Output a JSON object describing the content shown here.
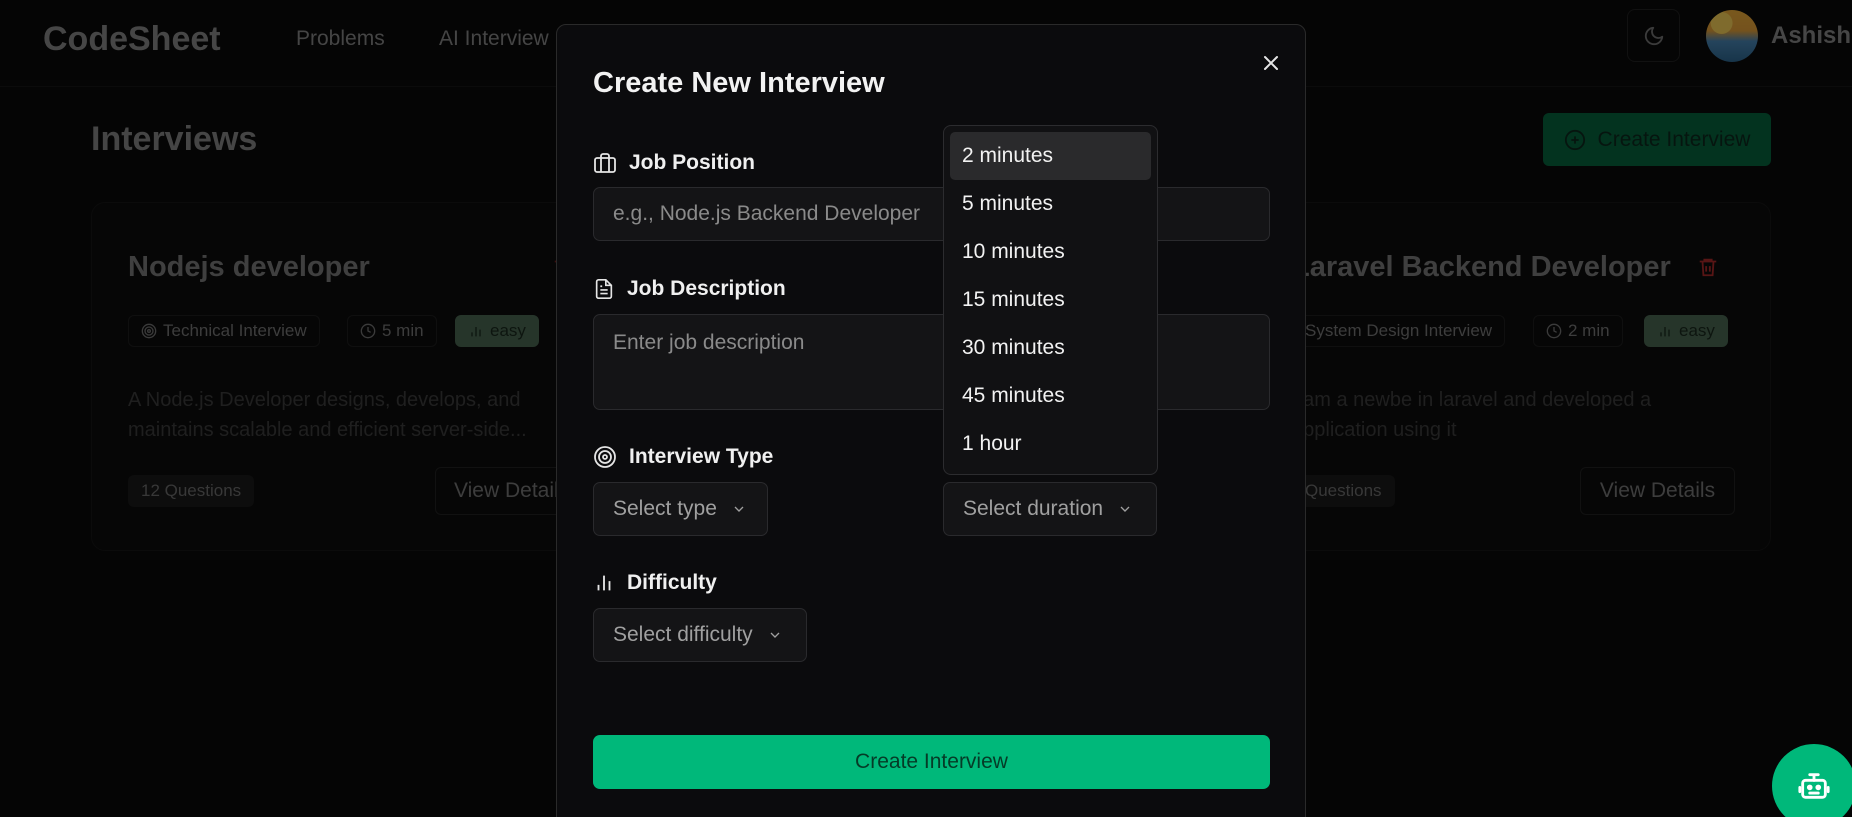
{
  "app": {
    "name": "CodeSheet"
  },
  "nav": {
    "links": [
      "Problems",
      "AI Interview"
    ]
  },
  "user": {
    "name": "Ashish"
  },
  "page": {
    "title": "Interviews",
    "create_button": "Create Interview"
  },
  "cards": [
    {
      "title": "Nodejs developer",
      "type": "Technical Interview",
      "duration": "5 min",
      "difficulty": "easy",
      "description": "A Node.js Developer designs, develops, and maintains scalable and efficient server-side...",
      "questions": "12 Questions",
      "view": "View Details"
    },
    {
      "title": "Laravel Backend Developer",
      "type": "System Design Interview",
      "duration": "2 min",
      "difficulty": "easy",
      "description": "I am a newbe in laravel and developed a application using it",
      "questions": "Questions",
      "view": "View Details"
    }
  ],
  "modal": {
    "title": "Create New Interview",
    "job_position": {
      "label": "Job Position",
      "placeholder": "e.g., Node.js Backend Developer"
    },
    "job_description": {
      "label": "Job Description",
      "placeholder": "Enter job description"
    },
    "interview_type": {
      "label": "Interview Type",
      "placeholder": "Select type"
    },
    "duration": {
      "placeholder": "Select duration"
    },
    "difficulty": {
      "label": "Difficulty",
      "placeholder": "Select difficulty"
    },
    "submit": "Create Interview"
  },
  "duration_options": [
    "2 minutes",
    "5 minutes",
    "10 minutes",
    "15 minutes",
    "30 minutes",
    "45 minutes",
    "1 hour"
  ],
  "colors": {
    "accent": "#00b87a",
    "danger": "#c0392b",
    "background": "#0a0a0a"
  }
}
